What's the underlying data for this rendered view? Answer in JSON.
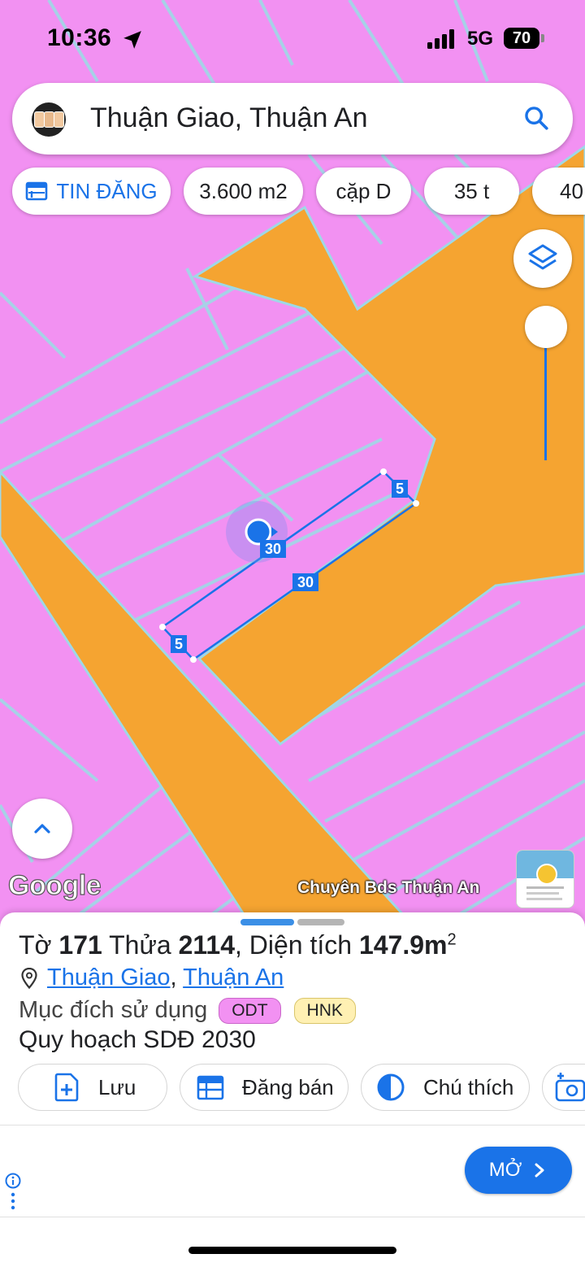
{
  "status_bar": {
    "time": "10:36",
    "network": "5G",
    "battery": "70"
  },
  "search": {
    "query": "Thuận Giao, Thuận An"
  },
  "chips": [
    "TIN ĐĂNG",
    "3.600 m2",
    "cặp D",
    "35 t",
    "40"
  ],
  "map": {
    "colors": {
      "residential": "#f291f2",
      "road": "#f5a431",
      "parcel_border": "#9fd8e6",
      "measure_line": "#1a73e8"
    },
    "measure_labels": [
      "5",
      "30",
      "30",
      "5"
    ],
    "watermark": "Chuyên Bds Thuận An",
    "attribution": "Google"
  },
  "parcel": {
    "sheet_label": "Tờ",
    "sheet_no": "171",
    "plot_label": "Thửa",
    "plot_no": "2114",
    "area_label": ", Diện tích",
    "area_value": "147.9m",
    "area_unit_sup": "2",
    "ward": "Thuận Giao",
    "separator": ",",
    "district": "Thuận An",
    "purpose_label": "Mục đích sử dụng",
    "purpose_tags": [
      "ODT",
      "HNK"
    ],
    "plan": "Quy hoạch SDĐ 2030"
  },
  "actions": [
    "Lưu",
    "Đăng bán",
    "Chú thích"
  ],
  "ad": {
    "open_label": "MỞ"
  }
}
